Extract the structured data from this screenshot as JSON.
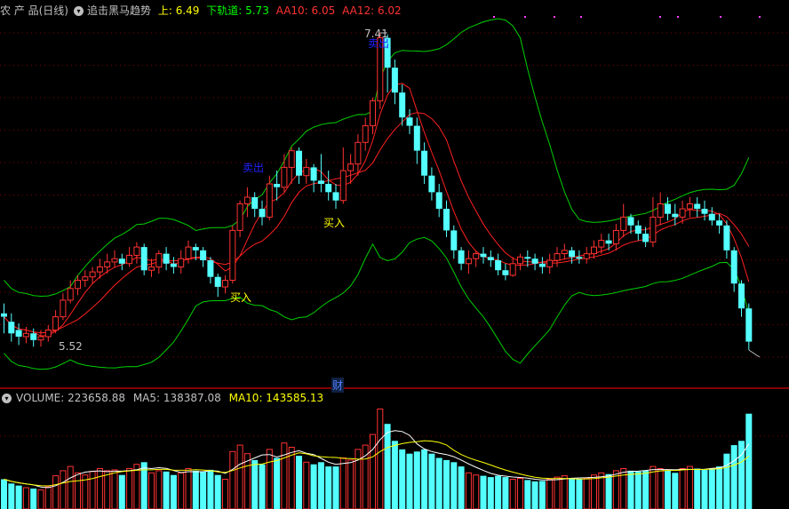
{
  "header": {
    "title": "农 产 品(日线)",
    "indicator": "追击黑马趋势",
    "upper": "上: 6.49",
    "lower": "下轨道: 5.73",
    "aa10": "AA10: 6.05",
    "aa12": "AA12: 6.02"
  },
  "volume_header": {
    "volume": "VOLUME: 223658.88",
    "ma5": "MA5: 138387.08",
    "ma10": "MA10: 143585.13"
  },
  "annotations": {
    "high_label": "7.41",
    "low_label": "5.52",
    "buy_label": "买入",
    "sell_label": "卖出",
    "fin_label": "财"
  },
  "colors": {
    "up": "#ff3232",
    "down": "#54ffff",
    "band": "#00d000",
    "ma": "#ff2020",
    "title": "#c0c0c0",
    "indicator": "#c0c0c0",
    "upper": "#ffff00",
    "lower": "#00ff00",
    "aa10": "#ff3232",
    "aa12": "#ff3232",
    "buy": "#ffff00",
    "sell": "#2020ff",
    "vol_ma5": "#ffffff",
    "vol_ma10": "#ffff00"
  },
  "chart_data": {
    "type": "candlestick",
    "price_range": [
      5.35,
      7.49
    ],
    "volume_max": 240000,
    "candles": [
      [
        5.72,
        5.7,
        5.78,
        5.6,
        70000
      ],
      [
        5.67,
        5.6,
        5.72,
        5.55,
        60000
      ],
      [
        5.62,
        5.58,
        5.66,
        5.53,
        55000
      ],
      [
        5.58,
        5.6,
        5.64,
        5.54,
        50000
      ],
      [
        5.6,
        5.56,
        5.63,
        5.52,
        48000
      ],
      [
        5.56,
        5.58,
        5.62,
        5.52,
        45000
      ],
      [
        5.58,
        5.62,
        5.65,
        5.55,
        52000
      ],
      [
        5.62,
        5.7,
        5.74,
        5.6,
        78000
      ],
      [
        5.7,
        5.8,
        5.84,
        5.68,
        90000
      ],
      [
        5.8,
        5.87,
        5.92,
        5.78,
        100000
      ],
      [
        5.87,
        5.92,
        5.95,
        5.83,
        85000
      ],
      [
        5.92,
        5.94,
        5.98,
        5.88,
        80000
      ],
      [
        5.94,
        5.97,
        6.0,
        5.9,
        88000
      ],
      [
        5.97,
        6.0,
        6.05,
        5.93,
        95000
      ],
      [
        6.0,
        6.03,
        6.08,
        5.96,
        90000
      ],
      [
        6.03,
        6.05,
        6.1,
        6.0,
        92000
      ],
      [
        6.05,
        6.02,
        6.08,
        5.98,
        80000
      ],
      [
        6.02,
        6.07,
        6.12,
        6.0,
        95000
      ],
      [
        6.07,
        6.12,
        6.15,
        6.02,
        105000
      ],
      [
        6.12,
        5.98,
        6.14,
        5.95,
        110000
      ],
      [
        5.98,
        6.0,
        6.05,
        5.94,
        85000
      ],
      [
        6.0,
        6.08,
        6.1,
        5.96,
        90000
      ],
      [
        6.08,
        6.02,
        6.12,
        5.98,
        88000
      ],
      [
        6.02,
        6.0,
        6.06,
        5.96,
        80000
      ],
      [
        6.0,
        6.05,
        6.1,
        5.96,
        85000
      ],
      [
        6.05,
        6.12,
        6.16,
        6.02,
        95000
      ],
      [
        6.12,
        6.1,
        6.14,
        6.04,
        90000
      ],
      [
        6.1,
        6.04,
        6.12,
        6.0,
        88000
      ],
      [
        6.04,
        5.94,
        6.06,
        5.9,
        92000
      ],
      [
        5.94,
        5.88,
        5.96,
        5.82,
        80000
      ],
      [
        5.88,
        5.92,
        5.95,
        5.84,
        70000
      ],
      [
        5.92,
        6.22,
        6.25,
        5.9,
        135000
      ],
      [
        6.22,
        6.38,
        6.4,
        6.18,
        150000
      ],
      [
        6.38,
        6.42,
        6.48,
        6.3,
        130000
      ],
      [
        6.42,
        6.35,
        6.45,
        6.3,
        115000
      ],
      [
        6.35,
        6.3,
        6.4,
        6.25,
        105000
      ],
      [
        6.3,
        6.5,
        6.55,
        6.28,
        140000
      ],
      [
        6.5,
        6.48,
        6.58,
        6.4,
        120000
      ],
      [
        6.48,
        6.6,
        6.68,
        6.45,
        155000
      ],
      [
        6.6,
        6.7,
        6.72,
        6.5,
        145000
      ],
      [
        6.7,
        6.55,
        6.72,
        6.5,
        125000
      ],
      [
        6.55,
        6.6,
        6.65,
        6.5,
        110000
      ],
      [
        6.6,
        6.52,
        6.62,
        6.45,
        105000
      ],
      [
        6.52,
        6.5,
        6.68,
        6.45,
        110000
      ],
      [
        6.5,
        6.45,
        6.58,
        6.4,
        100000
      ],
      [
        6.45,
        6.4,
        6.5,
        6.35,
        100000
      ],
      [
        6.4,
        6.58,
        6.72,
        6.38,
        120000
      ],
      [
        6.58,
        6.62,
        6.68,
        6.5,
        115000
      ],
      [
        6.62,
        6.75,
        6.8,
        6.55,
        140000
      ],
      [
        6.75,
        6.85,
        6.9,
        6.7,
        150000
      ],
      [
        6.85,
        7.0,
        7.02,
        6.8,
        175000
      ],
      [
        7.0,
        7.38,
        7.41,
        6.95,
        235000
      ],
      [
        7.38,
        7.2,
        7.4,
        7.05,
        200000
      ],
      [
        7.2,
        7.05,
        7.25,
        6.98,
        160000
      ],
      [
        7.05,
        6.9,
        7.1,
        6.85,
        140000
      ],
      [
        6.9,
        6.85,
        6.95,
        6.8,
        130000
      ],
      [
        6.85,
        6.7,
        6.9,
        6.62,
        135000
      ],
      [
        6.7,
        6.55,
        6.75,
        6.5,
        140000
      ],
      [
        6.55,
        6.45,
        6.6,
        6.4,
        130000
      ],
      [
        6.45,
        6.35,
        6.5,
        6.3,
        120000
      ],
      [
        6.35,
        6.22,
        6.4,
        6.18,
        115000
      ],
      [
        6.22,
        6.1,
        6.25,
        6.05,
        110000
      ],
      [
        6.1,
        6.02,
        6.12,
        5.98,
        100000
      ],
      [
        6.02,
        6.05,
        6.1,
        5.96,
        85000
      ],
      [
        6.05,
        6.08,
        6.1,
        6.0,
        80000
      ],
      [
        6.08,
        6.06,
        6.12,
        6.02,
        78000
      ],
      [
        6.06,
        6.04,
        6.1,
        6.0,
        75000
      ],
      [
        6.04,
        5.98,
        6.08,
        5.95,
        78000
      ],
      [
        5.98,
        5.95,
        6.02,
        5.92,
        75000
      ],
      [
        5.95,
        6.02,
        6.06,
        5.94,
        70000
      ],
      [
        6.02,
        6.06,
        6.08,
        5.98,
        72000
      ],
      [
        6.06,
        6.05,
        6.1,
        6.0,
        68000
      ],
      [
        6.05,
        6.02,
        6.08,
        5.98,
        65000
      ],
      [
        6.02,
        6.0,
        6.06,
        5.96,
        66000
      ],
      [
        6.0,
        6.04,
        6.08,
        5.96,
        70000
      ],
      [
        6.04,
        6.08,
        6.12,
        6.0,
        75000
      ],
      [
        6.08,
        6.1,
        6.14,
        6.05,
        78000
      ],
      [
        6.1,
        6.06,
        6.12,
        6.02,
        72000
      ],
      [
        6.06,
        6.05,
        6.1,
        6.02,
        70000
      ],
      [
        6.05,
        6.08,
        6.12,
        6.02,
        72000
      ],
      [
        6.08,
        6.12,
        6.16,
        6.05,
        80000
      ],
      [
        6.12,
        6.16,
        6.2,
        6.08,
        85000
      ],
      [
        6.16,
        6.14,
        6.2,
        6.1,
        82000
      ],
      [
        6.14,
        6.22,
        6.26,
        6.1,
        90000
      ],
      [
        6.22,
        6.3,
        6.38,
        6.18,
        95000
      ],
      [
        6.3,
        6.25,
        6.32,
        6.2,
        90000
      ],
      [
        6.25,
        6.2,
        6.28,
        6.16,
        88000
      ],
      [
        6.2,
        6.15,
        6.24,
        6.12,
        90000
      ],
      [
        6.15,
        6.3,
        6.42,
        6.12,
        100000
      ],
      [
        6.3,
        6.38,
        6.45,
        6.25,
        95000
      ],
      [
        6.38,
        6.32,
        6.42,
        6.28,
        90000
      ],
      [
        6.32,
        6.3,
        6.38,
        6.25,
        85000
      ],
      [
        6.3,
        6.35,
        6.4,
        6.26,
        95000
      ],
      [
        6.35,
        6.38,
        6.42,
        6.3,
        100000
      ],
      [
        6.38,
        6.35,
        6.42,
        6.3,
        95000
      ],
      [
        6.35,
        6.32,
        6.4,
        6.28,
        92000
      ],
      [
        6.32,
        6.28,
        6.36,
        6.25,
        95000
      ],
      [
        6.28,
        6.25,
        6.32,
        6.2,
        100000
      ],
      [
        6.25,
        6.1,
        6.28,
        6.05,
        130000
      ],
      [
        6.1,
        5.9,
        6.12,
        5.85,
        150000
      ],
      [
        5.9,
        5.75,
        5.92,
        5.7,
        160000
      ],
      [
        5.75,
        5.55,
        5.78,
        5.5,
        224000
      ]
    ]
  }
}
